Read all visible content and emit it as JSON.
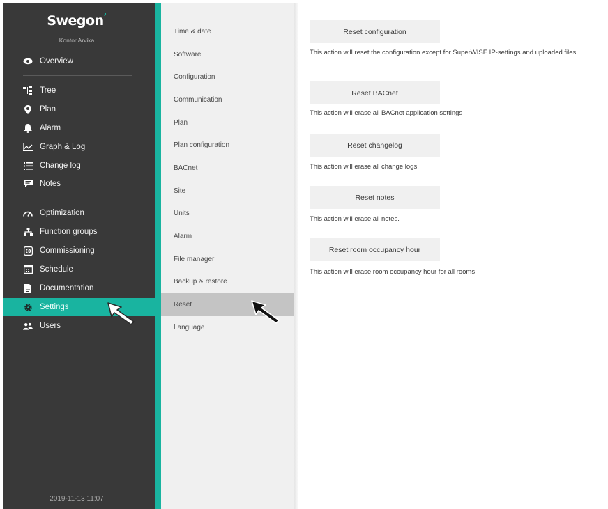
{
  "brand": {
    "logo": "Swegon",
    "site_name": "Kontor Arvika"
  },
  "nav": {
    "overview": "Overview",
    "tree": "Tree",
    "plan": "Plan",
    "alarm": "Alarm",
    "graph_log": "Graph & Log",
    "change_log": "Change log",
    "notes": "Notes",
    "optimization": "Optimization",
    "function_groups": "Function groups",
    "commissioning": "Commissioning",
    "schedule": "Schedule",
    "documentation": "Documentation",
    "settings": "Settings",
    "users": "Users"
  },
  "timestamp": "2019-11-13 11:07",
  "submenu": {
    "time_date": "Time & date",
    "software": "Software",
    "configuration": "Configuration",
    "communication": "Communication",
    "plan": "Plan",
    "plan_configuration": "Plan configuration",
    "bacnet": "BACnet",
    "site": "Site",
    "units": "Units",
    "alarm": "Alarm",
    "file_manager": "File manager",
    "backup_restore": "Backup & restore",
    "reset": "Reset",
    "language": "Language"
  },
  "actions": {
    "reset_configuration": {
      "label": "Reset configuration",
      "description": "This action will reset the configuration except for SuperWISE IP-settings and uploaded files."
    },
    "reset_bacnet": {
      "label": "Reset BACnet",
      "description": "This action will erase all BACnet application settings"
    },
    "reset_changelog": {
      "label": "Reset changelog",
      "description": "This action will erase all change logs."
    },
    "reset_notes": {
      "label": "Reset notes",
      "description": "This action will erase all notes."
    },
    "reset_room_occupancy": {
      "label": "Reset room occupancy hour",
      "description": "This action will erase room occupancy hour for all rooms."
    }
  },
  "colors": {
    "sidebar_bg": "#393939",
    "accent": "#19b4a0",
    "submenu_bg": "#f0f0f0",
    "submenu_active": "#c4c4c4"
  }
}
